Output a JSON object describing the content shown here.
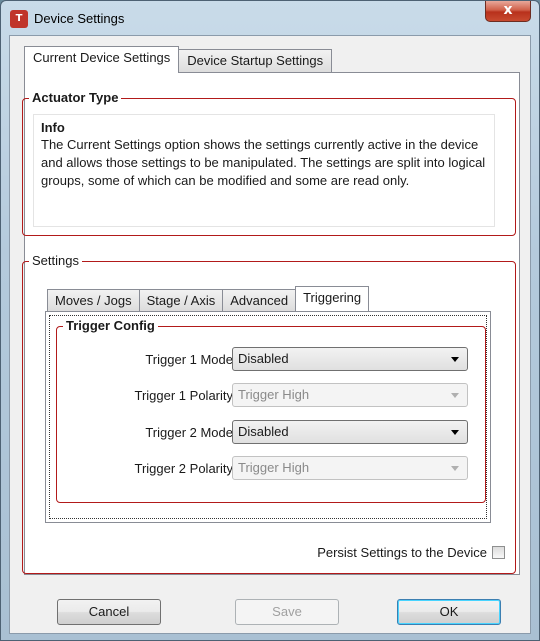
{
  "window": {
    "title": "Device Settings",
    "close_label": "x"
  },
  "tabs": [
    {
      "label": "Current Device Settings",
      "active": true
    },
    {
      "label": "Device Startup Settings",
      "active": false
    }
  ],
  "actuator": {
    "legend": "Actuator Type",
    "info_title": "Info",
    "info_text": "The Current Settings option shows the settings currently active in the device and allows those settings to be manipulated. The settings are split into logical groups, some of which can be modified and some are read only."
  },
  "settings": {
    "legend": "Settings",
    "tabs": [
      {
        "label": "Moves / Jogs",
        "active": false
      },
      {
        "label": "Stage / Axis",
        "active": false
      },
      {
        "label": "Advanced",
        "active": false
      },
      {
        "label": "Triggering",
        "active": true
      }
    ],
    "trigger_config": {
      "legend": "Trigger Config",
      "rows": [
        {
          "label": "Trigger 1 Mode",
          "value": "Disabled",
          "enabled": true
        },
        {
          "label": "Trigger 1 Polarity",
          "value": "Trigger High",
          "enabled": false
        },
        {
          "label": "Trigger 2 Mode",
          "value": "Disabled",
          "enabled": true
        },
        {
          "label": "Trigger 2 Polarity",
          "value": "Trigger High",
          "enabled": false
        }
      ]
    },
    "persist_label": "Persist Settings to the Device",
    "persist_checked": false
  },
  "buttons": {
    "cancel": "Cancel",
    "save": "Save",
    "ok": "OK"
  }
}
